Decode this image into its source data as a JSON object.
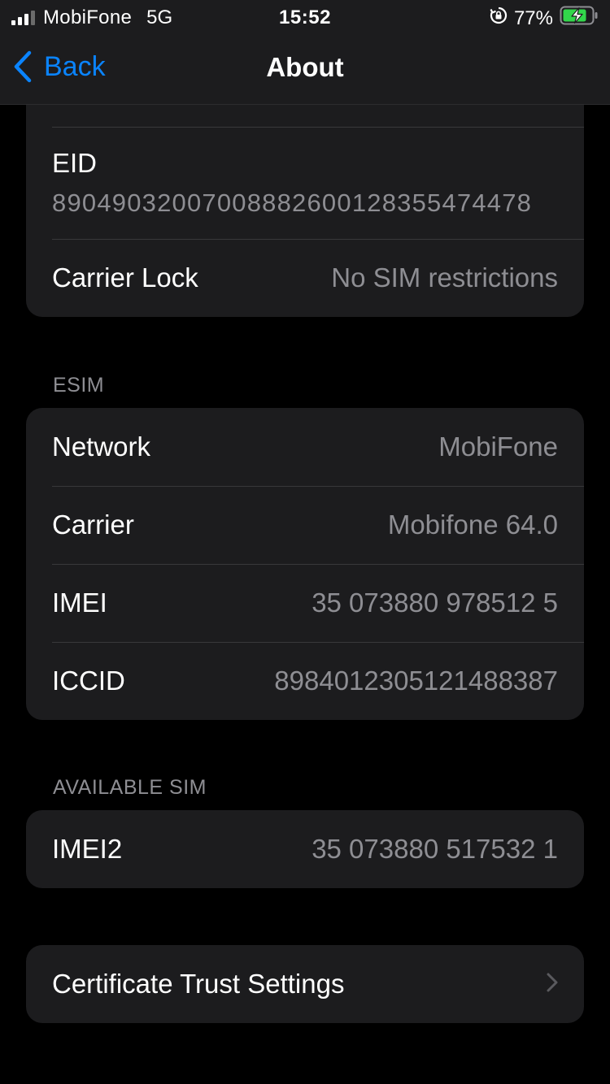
{
  "status": {
    "carrier": "MobiFone",
    "network": "5G",
    "time": "15:52",
    "battery": "77%"
  },
  "nav": {
    "back_label": "Back",
    "title": "About"
  },
  "top_group": {
    "eid_label": "EID",
    "eid_value": "89049032007008882600128355474478",
    "carrier_lock_label": "Carrier Lock",
    "carrier_lock_value": "No SIM restrictions"
  },
  "esim": {
    "header": "ESIM",
    "rows": [
      {
        "label": "Network",
        "value": "MobiFone"
      },
      {
        "label": "Carrier",
        "value": "Mobifone 64.0"
      },
      {
        "label": "IMEI",
        "value": "35 073880 978512 5"
      },
      {
        "label": "ICCID",
        "value": "8984012305121488387"
      }
    ]
  },
  "available_sim": {
    "header": "AVAILABLE SIM",
    "rows": [
      {
        "label": "IMEI2",
        "value": "35 073880 517532 1"
      }
    ]
  },
  "certificate": {
    "label": "Certificate Trust Settings"
  },
  "colors": {
    "background": "#000000",
    "cell": "#1c1c1e",
    "accent": "#0a84ff",
    "secondary_text": "#8e8e93",
    "battery_charging": "#32d74b"
  },
  "icons": [
    "signal-icon",
    "rotation-lock-icon",
    "battery-charging-icon",
    "back-chevron-icon",
    "chevron-right-icon"
  ]
}
